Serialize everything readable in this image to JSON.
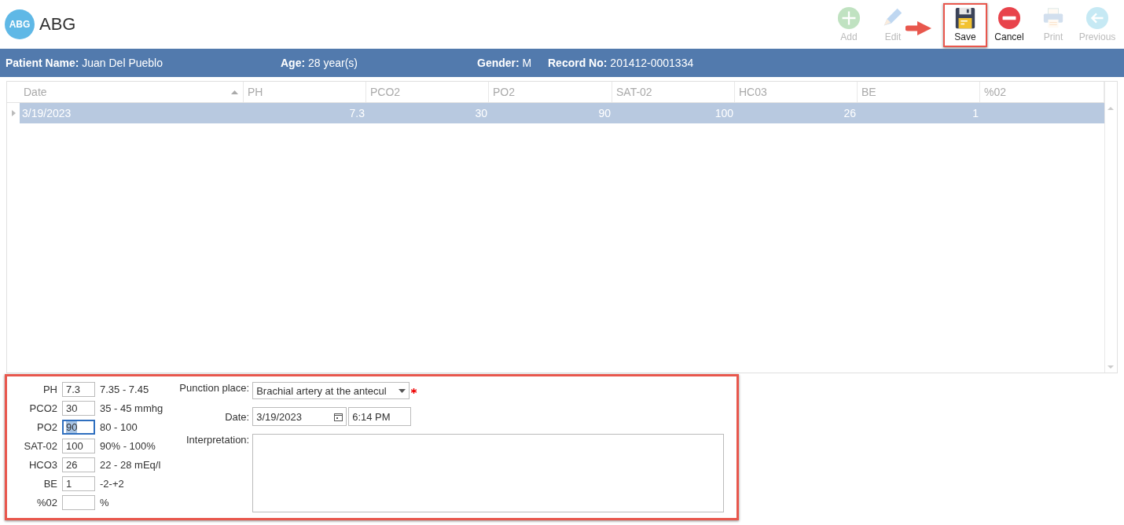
{
  "header": {
    "logo": "ABG",
    "title": "ABG"
  },
  "toolbar": [
    {
      "kind": "add",
      "label": "Add",
      "disabled": true,
      "highlighted": false
    },
    {
      "kind": "edit",
      "label": "Edit",
      "disabled": true,
      "highlighted": false
    },
    {
      "kind": "save",
      "label": "Save",
      "disabled": false,
      "highlighted": true
    },
    {
      "kind": "cancel",
      "label": "Cancel",
      "disabled": false,
      "highlighted": false
    },
    {
      "kind": "print",
      "label": "Print",
      "disabled": true,
      "highlighted": false
    },
    {
      "kind": "previous",
      "label": "Previous",
      "disabled": true,
      "highlighted": false
    }
  ],
  "patient_bar": [
    {
      "label": "Patient Name:",
      "value": "Juan Del Pueblo"
    },
    {
      "label": "Age:",
      "value": "28 year(s)"
    },
    {
      "label": "Gender:",
      "value": "M"
    },
    {
      "label": "Record No:",
      "value": "201412-0001334"
    }
  ],
  "table": {
    "columns": [
      {
        "label": "Date",
        "sorted": true
      },
      {
        "label": "PH",
        "sorted": false
      },
      {
        "label": "PCO2",
        "sorted": false
      },
      {
        "label": "PO2",
        "sorted": false
      },
      {
        "label": "SAT-02",
        "sorted": false
      },
      {
        "label": "HC03",
        "sorted": false
      },
      {
        "label": "BE",
        "sorted": false
      },
      {
        "label": "%02",
        "sorted": false
      }
    ],
    "rows": [
      {
        "selected": true,
        "cells": [
          "3/19/2023",
          "7.3",
          "30",
          "90",
          "100",
          "26",
          "1",
          ""
        ]
      }
    ]
  },
  "form": {
    "measurements": [
      {
        "label": "PH",
        "value": "7.3",
        "range": "7.35 - 7.45",
        "focused": false
      },
      {
        "label": "PCO2",
        "value": "30",
        "range": "35 - 45 mmhg",
        "focused": false
      },
      {
        "label": "PO2",
        "value": "90",
        "range": "80 - 100",
        "focused": true
      },
      {
        "label": "SAT-02",
        "value": "100",
        "range": "90% - 100%",
        "focused": false
      },
      {
        "label": "HCO3",
        "value": "26",
        "range": "22 - 28 mEq/l",
        "focused": false
      },
      {
        "label": "BE",
        "value": "1",
        "range": "-2-+2",
        "focused": false
      },
      {
        "label": "%02",
        "range": "%",
        "focused": false
      }
    ],
    "punction_place": {
      "label": "Punction place:",
      "value": "Brachial artery at the antecul",
      "required": true
    },
    "date": {
      "label": "Date:",
      "date": "3/19/2023",
      "time": "6:14 PM"
    },
    "interpretation": {
      "label": "Interpretation:"
    }
  }
}
